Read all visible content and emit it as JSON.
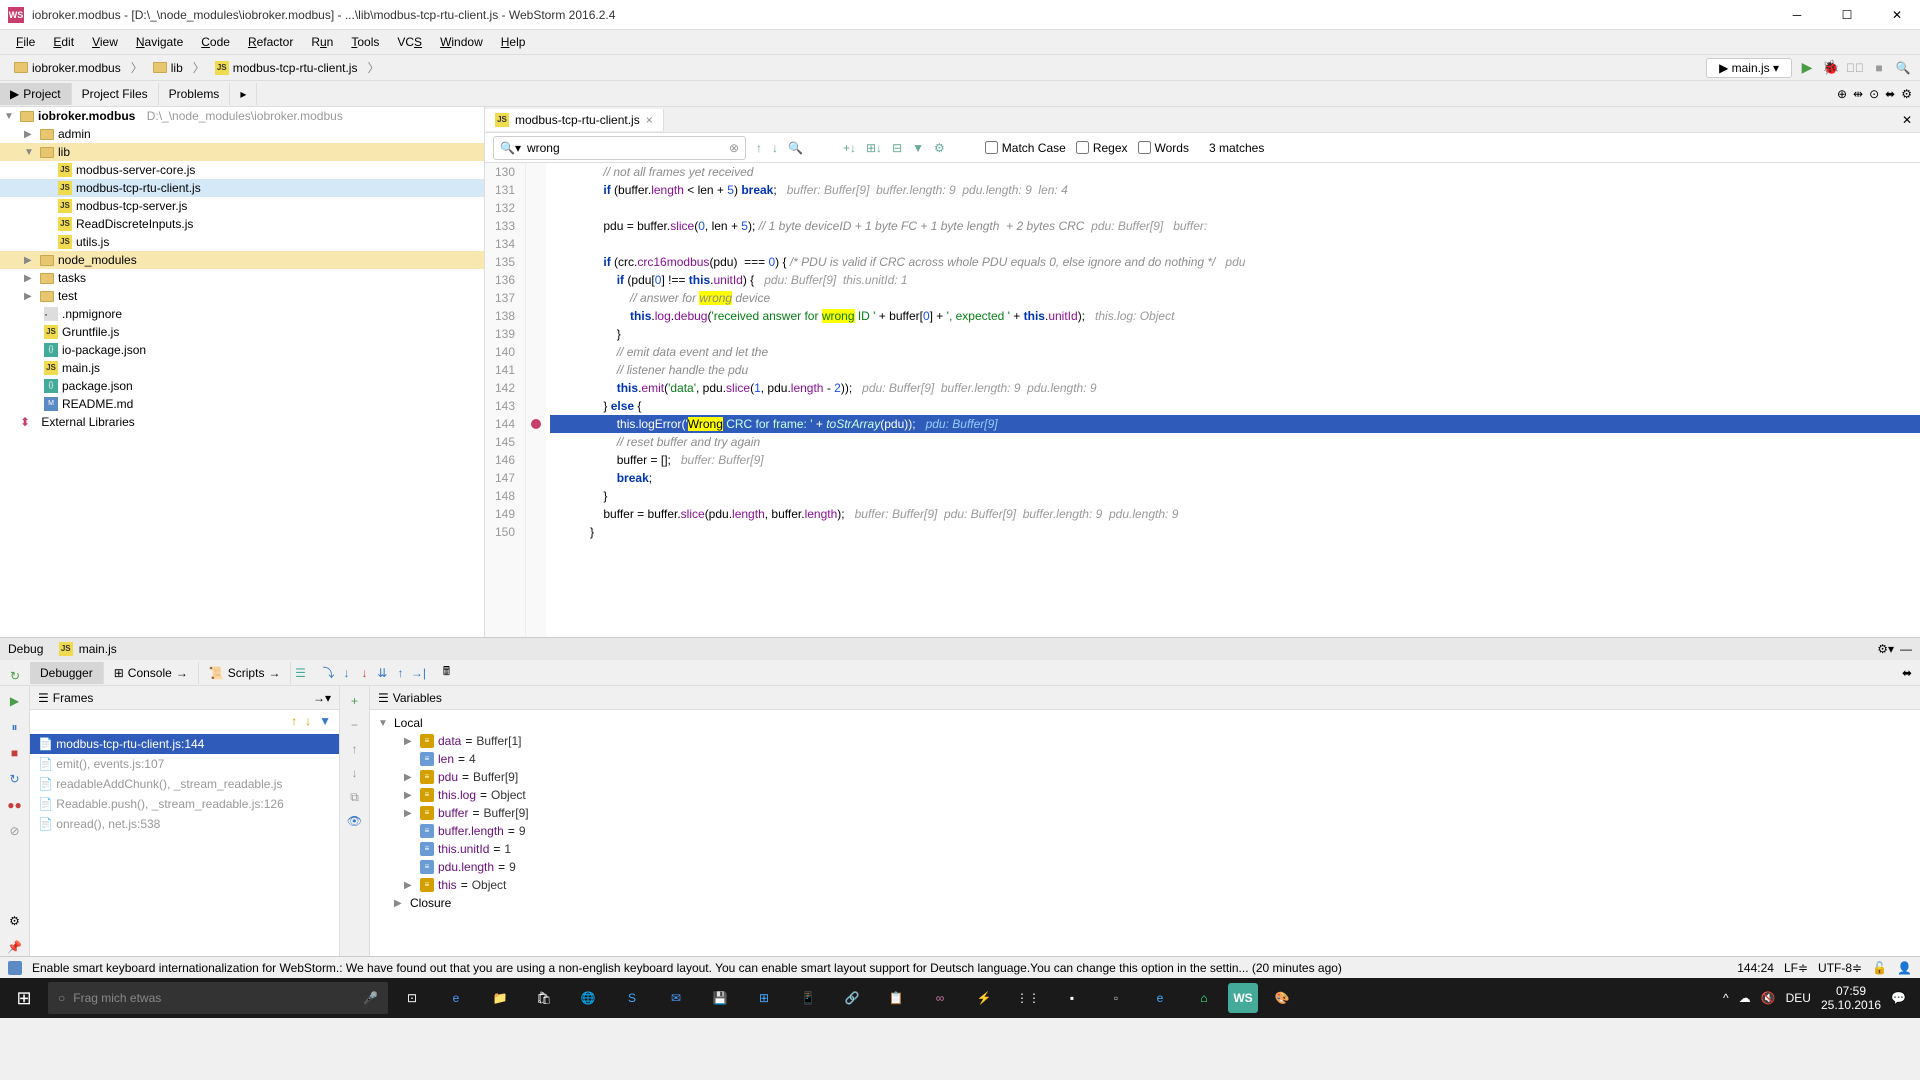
{
  "title": "iobroker.modbus - [D:\\_\\node_modules\\iobroker.modbus] - ...\\lib\\modbus-tcp-rtu-client.js - WebStorm 2016.2.4",
  "menu": [
    "File",
    "Edit",
    "View",
    "Navigate",
    "Code",
    "Refactor",
    "Run",
    "Tools",
    "VCS",
    "Window",
    "Help"
  ],
  "breadcrumb": {
    "root": "iobroker.modbus",
    "lib": "lib",
    "file": "modbus-tcp-rtu-client.js"
  },
  "runconfig": "main.js",
  "tooltabs": {
    "project": "Project",
    "files": "Project Files",
    "problems": "Problems"
  },
  "tree": {
    "root": "iobroker.modbus",
    "root_path": "D:\\_\\node_modules\\iobroker.modbus",
    "admin": "admin",
    "lib": "lib",
    "files": [
      "modbus-server-core.js",
      "modbus-tcp-rtu-client.js",
      "modbus-tcp-server.js",
      "ReadDiscreteInputs.js",
      "utils.js"
    ],
    "nm": "node_modules",
    "tasks": "tasks",
    "test": "test",
    "rootfiles": [
      ".npmignore",
      "Gruntfile.js",
      "io-package.json",
      "main.js",
      "package.json",
      "README.md"
    ],
    "ext": "External Libraries"
  },
  "editor_tab": "modbus-tcp-rtu-client.js",
  "search": {
    "placeholder": "",
    "value": "wrong",
    "matches": "3 matches",
    "matchcase": "Match Case",
    "regex": "Regex",
    "words": "Words"
  },
  "lines": {
    "start": 130,
    "end": 150,
    "exec": 144
  },
  "debug": {
    "label": "Debug",
    "target": "main.js"
  },
  "dbgtabs": {
    "debugger": "Debugger",
    "console": "Console",
    "scripts": "Scripts"
  },
  "frames": {
    "title": "Frames",
    "items": [
      {
        "t": "modbus-tcp-rtu-client.js:144",
        "sel": true
      },
      {
        "t": "emit(), events.js:107"
      },
      {
        "t": "readableAddChunk(), _stream_readable.js"
      },
      {
        "t": "Readable.push(), _stream_readable.js:126"
      },
      {
        "t": "onread(), net.js:538"
      }
    ]
  },
  "vars": {
    "title": "Variables",
    "local": "Local",
    "items": [
      {
        "n": "data",
        "v": "Buffer[1]",
        "obj": true,
        "exp": true
      },
      {
        "n": "len",
        "v": "4",
        "obj": false
      },
      {
        "n": "pdu",
        "v": "Buffer[9]",
        "obj": true,
        "exp": true
      },
      {
        "n": "this.log",
        "v": "Object",
        "obj": true,
        "exp": true
      },
      {
        "n": "buffer",
        "v": "Buffer[9]",
        "obj": true,
        "exp": true
      },
      {
        "n": "buffer.length",
        "v": "9",
        "obj": false
      },
      {
        "n": "this.unitId",
        "v": "1",
        "obj": false
      },
      {
        "n": "pdu.length",
        "v": "9",
        "obj": false
      },
      {
        "n": "this",
        "v": "Object",
        "obj": true,
        "exp": true
      }
    ],
    "closure": "Closure"
  },
  "status": {
    "msg": "Enable smart keyboard internationalization for WebStorm.: We have found out that you are using a non-english keyboard layout. You can enable smart layout support for Deutsch language.You can change this option in the settin... (20 minutes ago)",
    "pos": "144:24",
    "le": "LF",
    "enc": "UTF-8"
  },
  "taskbar": {
    "search": "Frag mich etwas",
    "lang": "DEU",
    "time": "07:59",
    "date": "25.10.2016"
  }
}
